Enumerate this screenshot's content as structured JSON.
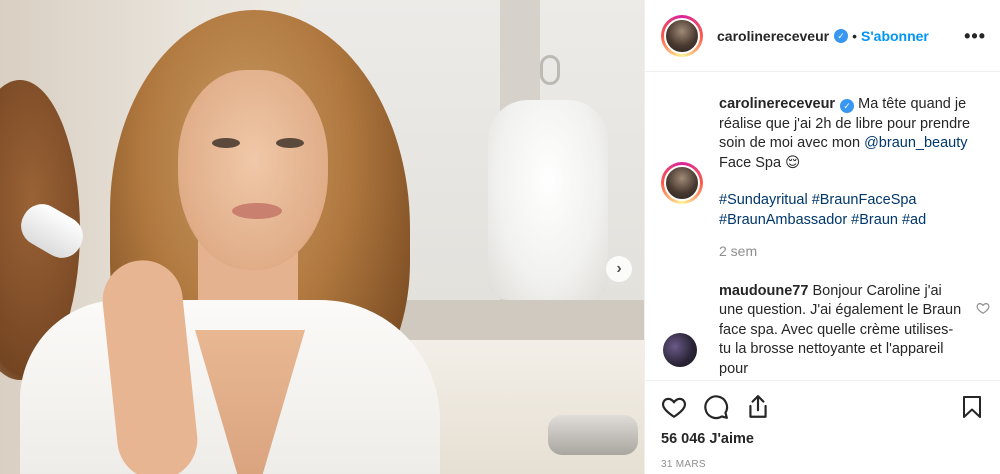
{
  "header": {
    "username": "carolinereceveur",
    "follow_label": "S'abonner",
    "more_label": "•••"
  },
  "caption": {
    "username": "carolinereceveur",
    "text_before_mention": "Ma tête quand je réalise que j'ai 2h de libre pour prendre soin de moi avec mon",
    "mention": "@braun_beauty",
    "text_after_mention": "Face Spa 😌",
    "hashtags_line1": "#Sundayritual #BraunFaceSpa",
    "hashtags_line2": "#BraunAmbassador #Braun #ad",
    "time": "2 sem"
  },
  "comment": {
    "username": "maudoune77",
    "text": "Bonjour Caroline j'ai une question. J'ai également le Braun face spa. Avec quelle crème utilises-tu la brosse nettoyante et l'appareil pour"
  },
  "footer": {
    "likes": "56 046 J'aime",
    "date": "31 mars"
  },
  "icons": {
    "like": "heart-icon",
    "comment": "comment-icon",
    "share": "share-icon",
    "save": "bookmark-icon",
    "next": "chevron-right-icon",
    "verified": "verified-badge-icon"
  },
  "colors": {
    "link": "#0095f6",
    "hashtag": "#00376b",
    "meta": "#8e8e8e",
    "verified": "#3897f0"
  }
}
